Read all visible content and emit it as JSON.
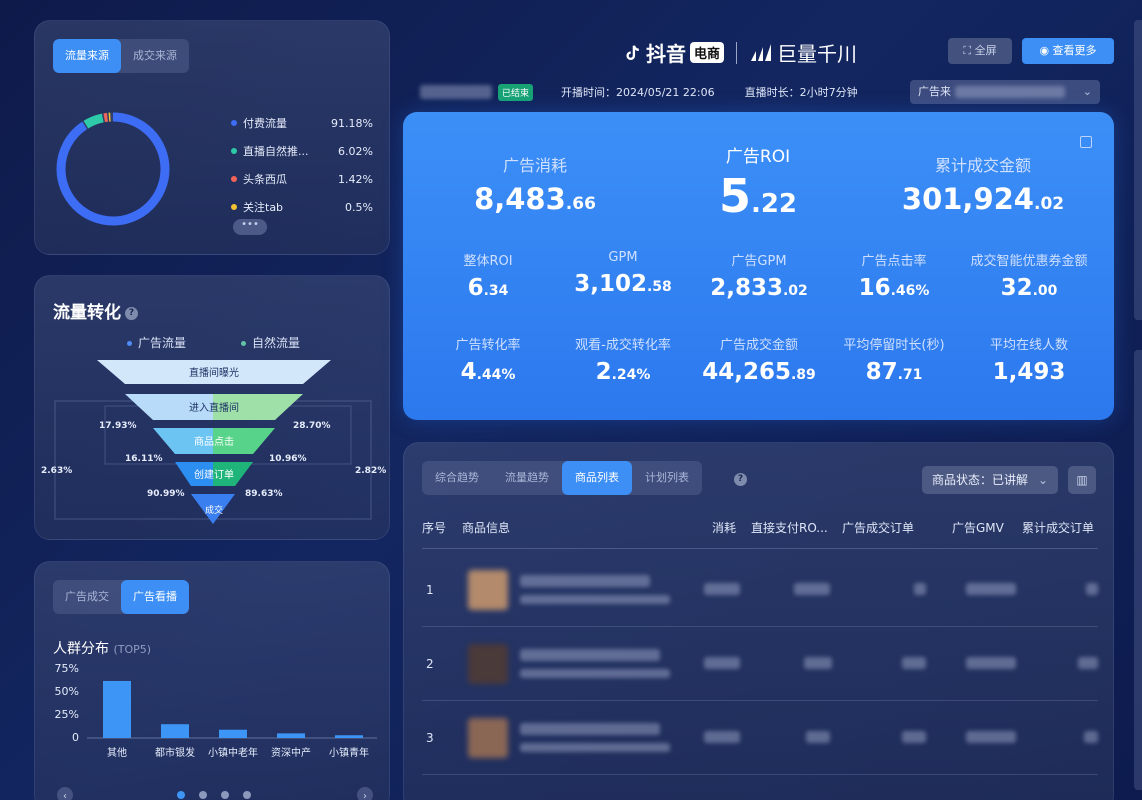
{
  "source": {
    "tabs": [
      {
        "label": "流量来源",
        "active": true
      },
      {
        "label": "成交来源",
        "active": false
      }
    ],
    "items": [
      {
        "label": "付费流量",
        "value": "91.18%",
        "pct": 91.18,
        "color": "#3d6cf5"
      },
      {
        "label": "直播自然推...",
        "value": "6.02%",
        "pct": 6.02,
        "color": "#2ec9a8"
      },
      {
        "label": "头条西瓜",
        "value": "1.42%",
        "pct": 1.42,
        "color": "#f0645a"
      },
      {
        "label": "关注tab",
        "value": "0.5%",
        "pct": 0.5,
        "color": "#f2c230"
      }
    ],
    "more": "•••"
  },
  "funnel": {
    "title": "流量转化",
    "legend": [
      {
        "label": "广告流量",
        "color": "#4f8cf5"
      },
      {
        "label": "自然流量",
        "color": "#63c4a6"
      }
    ],
    "stages": [
      "直播间曝光",
      "进入直播间",
      "商品点击",
      "创建订单",
      "成交"
    ],
    "left_rates": [
      "17.93%",
      "16.11%",
      "90.99%"
    ],
    "right_rates": [
      "28.70%",
      "10.96%",
      "89.63%"
    ],
    "outer_left": "2.63%",
    "outer_right": "2.82%"
  },
  "audience": {
    "tabs": [
      {
        "label": "广告成交",
        "active": false
      },
      {
        "label": "广告看播",
        "active": true
      }
    ],
    "title": "人群分布",
    "subtitle": "(TOP5)",
    "chart_data": {
      "type": "bar",
      "categories": [
        "其他",
        "都市银发",
        "小镇中老年",
        "资深中产",
        "小镇青年"
      ],
      "values": [
        62,
        15,
        9,
        5,
        3
      ],
      "yticks": [
        "75%",
        "50%",
        "25%",
        "0"
      ],
      "ylim": [
        0,
        75
      ],
      "color": "#3d95f5"
    }
  },
  "header": {
    "brand_douyin": "抖音",
    "brand_tag": "电商",
    "brand_qianchuan": "巨量千川",
    "btn_fullscreen": "全屏",
    "btn_more": "查看更多",
    "status": "已结束",
    "start_time": "开播时间：2024/05/21 22:06",
    "duration": "直播时长：2小时7分钟",
    "select_value": "广告来"
  },
  "kpi": {
    "top": [
      {
        "label": "广告消耗",
        "int": "8,483",
        "dec": ".66"
      },
      {
        "label": "广告ROI",
        "int": "5",
        "dec": ".22"
      },
      {
        "label": "累计成交金额",
        "int": "301,924",
        "dec": ".02"
      }
    ],
    "row1": [
      {
        "label": "整体ROI",
        "int": "6",
        "dec": ".34"
      },
      {
        "label": "GPM",
        "int": "3,102",
        "dec": ".58"
      },
      {
        "label": "广告GPM",
        "int": "2,833",
        "dec": ".02"
      },
      {
        "label": "广告点击率",
        "int": "16",
        "dec": ".46%"
      },
      {
        "label": "成交智能优惠券金额",
        "int": "32",
        "dec": ".00"
      }
    ],
    "row2": [
      {
        "label": "广告转化率",
        "int": "4",
        "dec": ".44%"
      },
      {
        "label": "观看-成交转化率",
        "int": "2",
        "dec": ".24%"
      },
      {
        "label": "广告成交金额",
        "int": "44,265",
        "dec": ".89"
      },
      {
        "label": "平均停留时长(秒)",
        "int": "87",
        "dec": ".71"
      },
      {
        "label": "平均在线人数",
        "int": "1,493",
        "dec": ""
      }
    ]
  },
  "list": {
    "tabs": [
      {
        "label": "综合趋势",
        "active": false
      },
      {
        "label": "流量趋势",
        "active": false
      },
      {
        "label": "商品列表",
        "active": true
      },
      {
        "label": "计划列表",
        "active": false
      }
    ],
    "status_select": "商品状态：已讲解",
    "columns": [
      "序号",
      "商品信息",
      "消耗",
      "直接支付RO...",
      "广告成交订单",
      "广告GMV",
      "累计成交订单"
    ],
    "rows": [
      "1",
      "2",
      "3"
    ]
  }
}
